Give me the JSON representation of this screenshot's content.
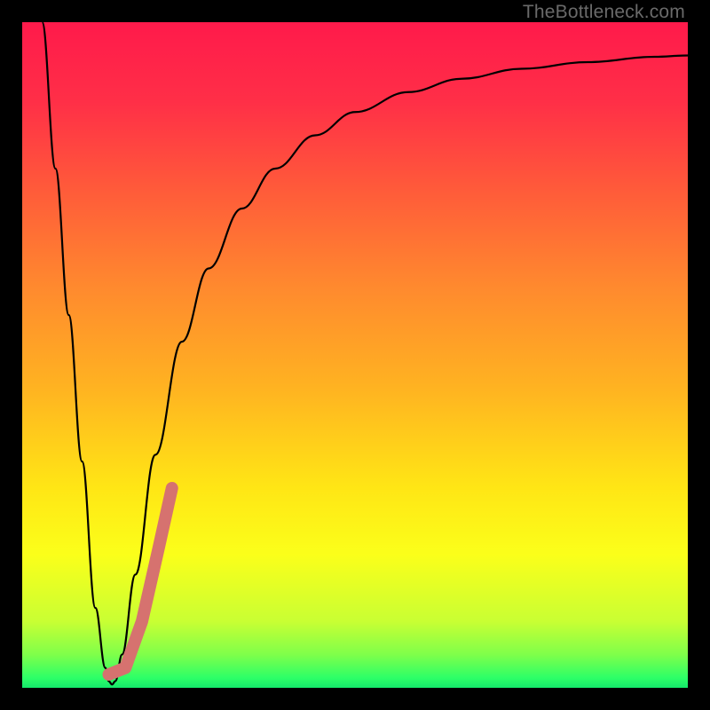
{
  "watermark": "TheBottleneck.com",
  "gradient": {
    "stops": [
      {
        "offset": 0.0,
        "color": "#ff1a4b"
      },
      {
        "offset": 0.12,
        "color": "#ff2f47"
      },
      {
        "offset": 0.25,
        "color": "#ff5a3a"
      },
      {
        "offset": 0.4,
        "color": "#ff8a2e"
      },
      {
        "offset": 0.55,
        "color": "#ffb321"
      },
      {
        "offset": 0.7,
        "color": "#ffe615"
      },
      {
        "offset": 0.8,
        "color": "#fbff1a"
      },
      {
        "offset": 0.9,
        "color": "#c9ff33"
      },
      {
        "offset": 0.95,
        "color": "#7fff4a"
      },
      {
        "offset": 0.985,
        "color": "#2dff67"
      },
      {
        "offset": 1.0,
        "color": "#15e86b"
      }
    ]
  },
  "curve_color": "#000000",
  "curve_width": 2.2,
  "marker": {
    "color": "#d6726f",
    "width": 14
  },
  "chart_data": {
    "type": "line",
    "title": "",
    "xlabel": "",
    "ylabel": "",
    "xlim": [
      0,
      100
    ],
    "ylim": [
      0,
      100
    ],
    "series": [
      {
        "name": "bottleneck-curve",
        "x": [
          3,
          5,
          7,
          9,
          11,
          12.5,
          13,
          13.5,
          14,
          15,
          17,
          20,
          24,
          28,
          33,
          38,
          44,
          50,
          58,
          66,
          75,
          85,
          95,
          100
        ],
        "y": [
          100,
          78,
          56,
          34,
          12,
          3,
          1,
          0.5,
          1,
          5,
          17,
          35,
          52,
          63,
          72,
          78,
          83,
          86.5,
          89.5,
          91.5,
          93,
          94,
          94.8,
          95
        ]
      }
    ],
    "highlight_segment": {
      "description": "salmon thick segment near curve bottom",
      "points": [
        {
          "x": 13.0,
          "y": 2.0
        },
        {
          "x": 15.5,
          "y": 3.0
        },
        {
          "x": 18.0,
          "y": 10.0
        },
        {
          "x": 20.5,
          "y": 21.0
        },
        {
          "x": 22.5,
          "y": 30.0
        }
      ]
    }
  }
}
